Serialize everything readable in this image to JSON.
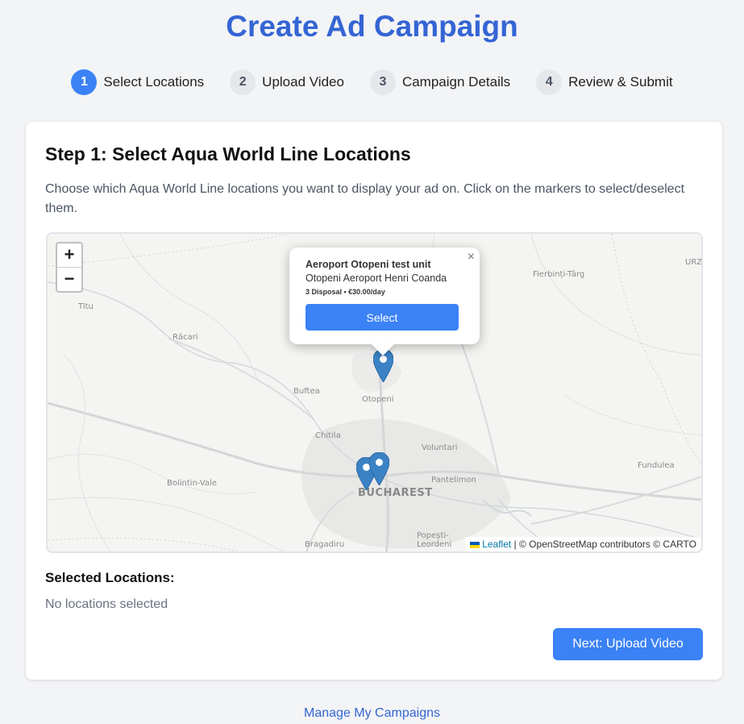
{
  "page": {
    "title": "Create Ad Campaign"
  },
  "steps": [
    {
      "num": "1",
      "label": "Select Locations",
      "active": true
    },
    {
      "num": "2",
      "label": "Upload Video",
      "active": false
    },
    {
      "num": "3",
      "label": "Campaign Details",
      "active": false
    },
    {
      "num": "4",
      "label": "Review & Submit",
      "active": false
    }
  ],
  "card": {
    "title": "Step 1: Select Aqua World Line Locations",
    "description": "Choose which Aqua World Line locations you want to display your ad on. Click on the markers to select/deselect them."
  },
  "map": {
    "zoom_in": "+",
    "zoom_out": "−",
    "places": {
      "titu": "Titu",
      "racari": "Răcari",
      "buftea": "Buftea",
      "otopeni": "Otopeni",
      "chitila": "Chitila",
      "voluntari": "Voluntari",
      "bolintin": "Bolintin-Vale",
      "pantelimon": "Pantelimon",
      "bucharest": "BUCHAREST",
      "fundulea": "Fundulea",
      "fierbinti": "Fierbinți-Târg",
      "bragadiru": "Bragadiru",
      "popesti1": "Popești-",
      "popesti2": "Leordeni",
      "urz": "URZ"
    },
    "popup": {
      "title": "Aeroport Otopeni test unit",
      "address": "Otopeni Aeroport Henri Coanda",
      "meta": "3 Disposal • €30.00/day",
      "select_label": "Select",
      "close": "×"
    },
    "attribution": {
      "leaflet": "Leaflet",
      "rest": " | © OpenStreetMap contributors © CARTO"
    },
    "marker_color": "#3b82c4"
  },
  "selected": {
    "heading": "Selected Locations:",
    "empty": "No locations selected"
  },
  "next_button": "Next: Upload Video",
  "manage_link": "Manage My Campaigns",
  "colors": {
    "accent": "#3b82f6",
    "title": "#3565d4"
  }
}
